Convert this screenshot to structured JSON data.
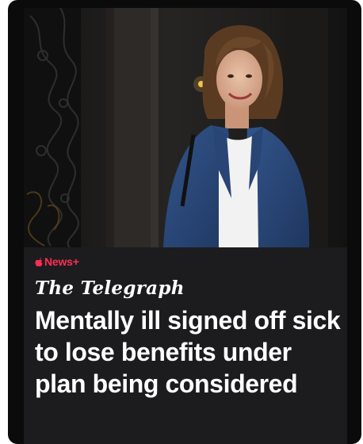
{
  "story": {
    "badge_label": "News+",
    "publisher": "The Telegraph",
    "headline": "Mentally ill signed off sick to lose benefits under plan being considered"
  },
  "colors": {
    "badge": "#ff2d55",
    "card_background": "#1c1c1e",
    "frame_background": "#0b0b0b",
    "text": "#ffffff",
    "jacket": "#2c4a7c"
  },
  "icons": {
    "badge_icon": "apple-logo-icon"
  }
}
